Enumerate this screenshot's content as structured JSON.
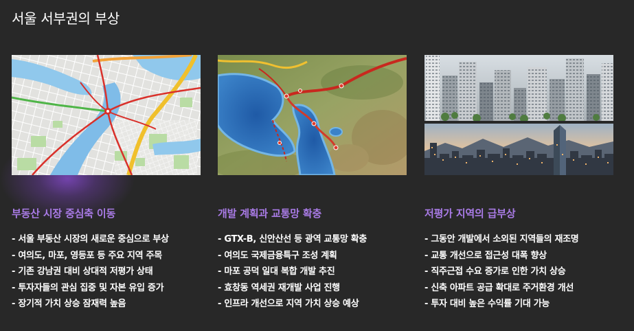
{
  "page": {
    "title": "서울 서부권의 부상"
  },
  "theme": {
    "background": "#282828",
    "accent": "#a97be6",
    "text": "#ffffff",
    "glow": "#7d48b8"
  },
  "columns": [
    {
      "heading": "부동산 시장 중심축 이동",
      "bullets": [
        "- 서울 부동산 시장의 새로운 중심으로 부상",
        "- 여의도, 마포, 영등포 등 주요 지역 주목",
        "- 기존 강남권 대비 상대적 저평가 상태",
        "- 투자자들의 관심 집중 및 자본 유입 증가",
        "- 장기적 가치 상승 잠재력 높음"
      ]
    },
    {
      "heading": "개발 계획과 교통망 확충",
      "bullets": [
        "- GTX-B, 신안산선 등 광역 교통망 확충",
        "- 여의도 국제금융특구 조성 계획",
        "- 마포 공덕 일대 복합 개발 추진",
        "- 효창동 역세권 재개발 사업 진행",
        "- 인프라 개선으로 지역 가치 상승 예상"
      ]
    },
    {
      "heading": "저평가 지역의 급부상",
      "bullets": [
        "- 그동안 개발에서 소외된 지역들의 재조명",
        "- 교통 개선으로 접근성 대폭 향상",
        "- 직주근접 수요 증가로 인한 가치 상승",
        "- 신축 아파트 공급 확대로 주거환경 개선",
        "- 투자 대비 높은 수익률 기대 가능"
      ]
    }
  ]
}
